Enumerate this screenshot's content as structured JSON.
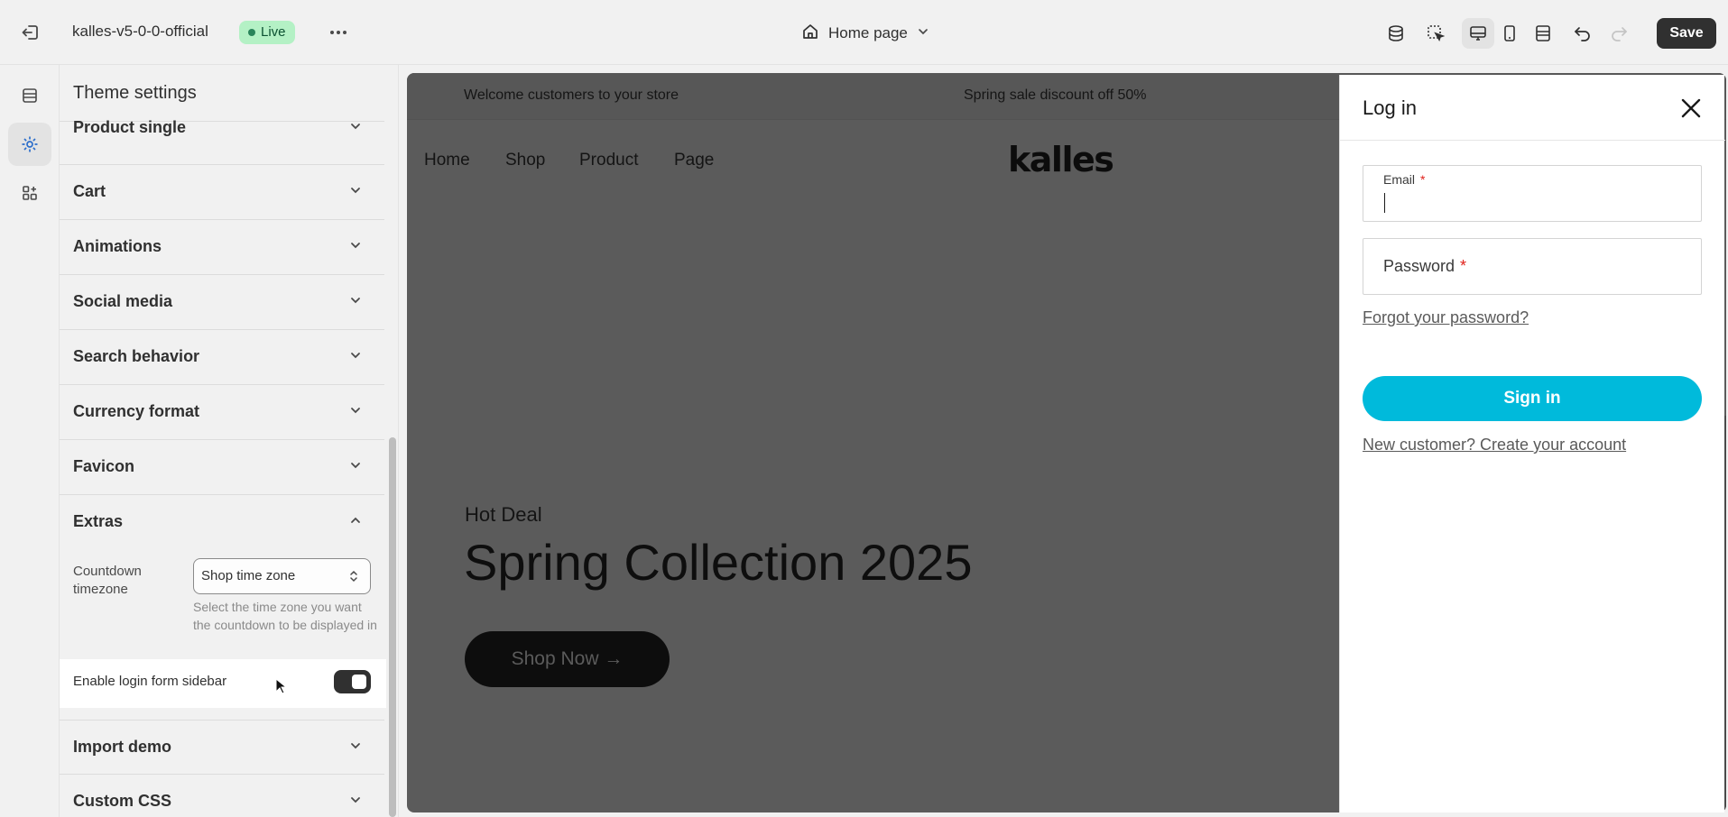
{
  "topbar": {
    "store_name": "kalles-v5-0-0-official",
    "status_badge": "Live",
    "page_selector": "Home page",
    "save_label": "Save",
    "icons": [
      "exit-icon",
      "more-icon",
      "home-icon",
      "chevron-down-icon",
      "database-icon",
      "inspector-icon",
      "desktop-icon",
      "mobile-icon",
      "full-width-icon",
      "undo-icon",
      "redo-icon"
    ]
  },
  "rail": {
    "items": [
      "sections-icon",
      "theme-settings-icon",
      "app-embeds-icon"
    ],
    "active": "theme-settings-icon"
  },
  "panel": {
    "title": "Theme settings",
    "sections": [
      {
        "label": "Product single"
      },
      {
        "label": "Cart"
      },
      {
        "label": "Animations"
      },
      {
        "label": "Social media"
      },
      {
        "label": "Search behavior"
      },
      {
        "label": "Currency format"
      },
      {
        "label": "Favicon"
      },
      {
        "label": "Extras"
      },
      {
        "label": "Import demo"
      },
      {
        "label": "Custom CSS"
      }
    ],
    "extras": {
      "countdown_label_1": "Countdown",
      "countdown_label_2": "timezone",
      "countdown_value": "Shop time zone",
      "help_text": "Select the time zone you want the countdown to be displayed in",
      "toggle_label": "Enable login form sidebar",
      "toggle_on": true
    }
  },
  "preview": {
    "announcement_left": "Welcome customers to your store",
    "announcement_center": "Spring sale discount off 50%",
    "nav": [
      "Home",
      "Shop",
      "Product",
      "Page"
    ],
    "logo": "kalles",
    "hero_kicker": "Hot Deal",
    "hero_title": "Spring Collection 2025",
    "hero_button": "Shop Now →"
  },
  "drawer": {
    "title": "Log in",
    "email_label": "Email",
    "password_label": "Password",
    "required_mark": "*",
    "forgot_link": "Forgot your password?",
    "signin_button": "Sign in",
    "register_link": "New customer? Create your account"
  },
  "colors": {
    "accent_button": "#00badb",
    "live_badge_bg": "#b4f1c5",
    "save_bg": "#303030"
  }
}
